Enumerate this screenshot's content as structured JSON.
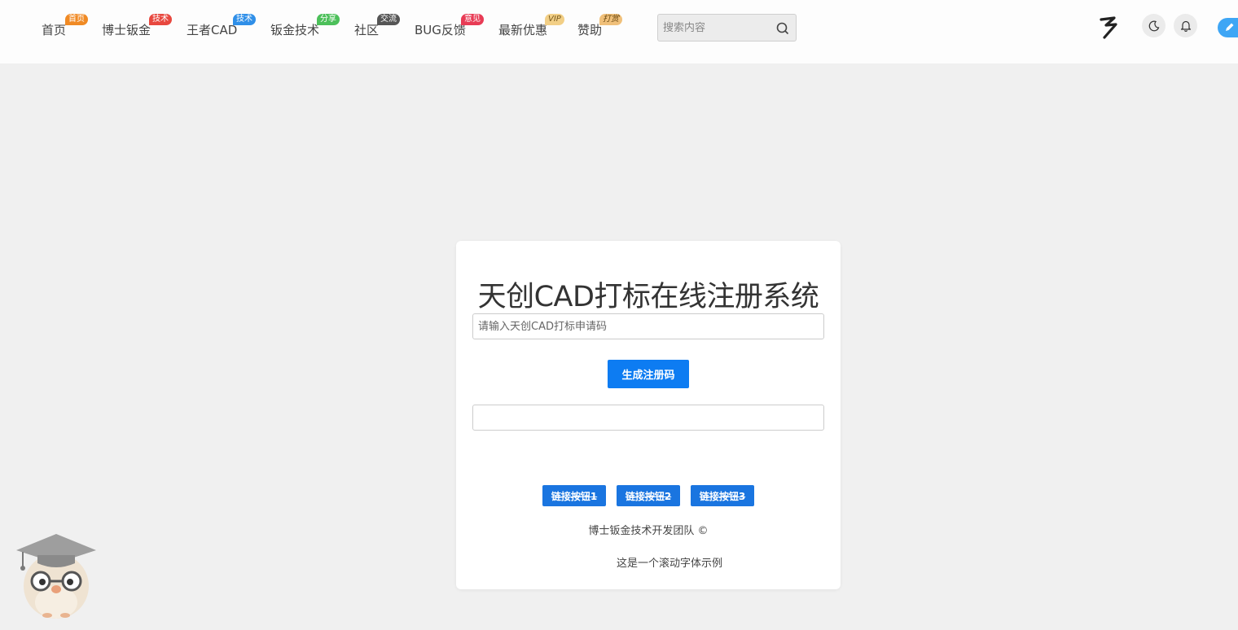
{
  "nav": {
    "items": [
      {
        "label": "首页",
        "badge": "首页",
        "badge_color": "#f08a24"
      },
      {
        "label": "博士钣金",
        "badge": "技术",
        "badge_color": "#e8483f"
      },
      {
        "label": "王者CAD",
        "badge": "技术",
        "badge_color": "#2f8fe8"
      },
      {
        "label": "钣金技术",
        "badge": "分享",
        "badge_color": "#4cc05a"
      },
      {
        "label": "社区",
        "badge": "交流",
        "badge_color": "#555555"
      },
      {
        "label": "BUG反馈",
        "badge": "意见",
        "badge_color": "#e83b55"
      },
      {
        "label": "最新优惠",
        "badge": "VIP",
        "badge_color": "#f2cf86"
      },
      {
        "label": "赞助",
        "badge": "打赏",
        "badge_color": "#f0c07a"
      }
    ]
  },
  "search": {
    "placeholder": "搜索内容",
    "icon": "search-icon"
  },
  "header_icons": [
    "logo-icon",
    "moon-icon",
    "bell-icon",
    "pen-icon"
  ],
  "card": {
    "title": "天创CAD打标在线注册系统",
    "code_placeholder": "请输入天创CAD打标申请码",
    "generate_label": "生成注册码",
    "result_value": "",
    "links": [
      "链接按钮1",
      "链接按钮2",
      "链接按钮3"
    ],
    "team": "博士钣金技术开发团队 ©",
    "marquee": "这是一个滚动字体示例"
  },
  "colors": {
    "accent": "#0d7cf2",
    "link_button": "#1a75e0",
    "page_bg": "#f0f0f0"
  }
}
